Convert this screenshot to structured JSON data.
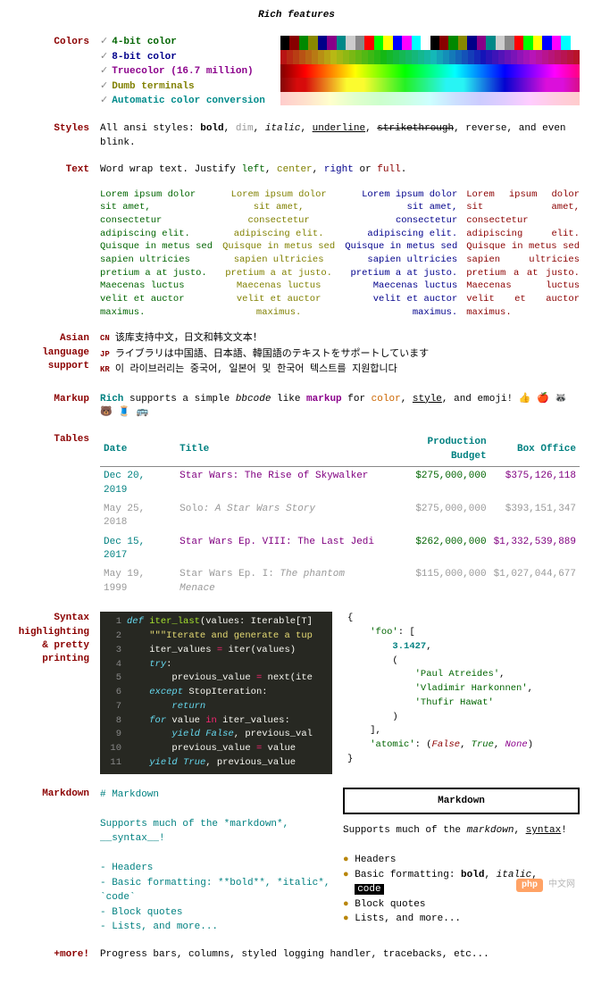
{
  "title": "Rich features",
  "labels": {
    "colors": "Colors",
    "styles": "Styles",
    "text": "Text",
    "asian": "Asian language support",
    "markup": "Markup",
    "tables": "Tables",
    "syntax": "Syntax highlighting & pretty printing",
    "markdown": "Markdown",
    "more": "+more!"
  },
  "colors": {
    "items": [
      {
        "text": "4-bit color",
        "class": "green"
      },
      {
        "text": "8-bit color",
        "class": "blue"
      },
      {
        "text": "Truecolor (16.7 million)",
        "class": "magenta"
      },
      {
        "text": "Dumb terminals",
        "class": "yellow"
      },
      {
        "text": "Automatic color conversion",
        "class": "cyan"
      }
    ]
  },
  "styles": {
    "prefix": "All ansi styles: ",
    "bold": "bold",
    "dim": "dim",
    "italic": "italic",
    "underline": "underline",
    "strike": "strikethrough",
    "suffix": ", reverse, and even blink."
  },
  "text": {
    "prefix": "Word wrap text. Justify ",
    "left": "left",
    "center": "center",
    "right": "right",
    "or": " or ",
    "full": "full",
    "period": "."
  },
  "lorem": "Lorem ipsum dolor sit amet, consectetur adipiscing elit. Quisque in metus sed sapien ultricies pretium a at justo. Maecenas luctus velit et auctor maximus.",
  "asian": {
    "cn_tag": "CN",
    "cn": "该库支持中文，日文和韩文文本！",
    "jp_tag": "JP",
    "jp": "ライブラリは中国語、日本語、韓国語のテキストをサポートしています",
    "kr_tag": "KR",
    "kr": "이 라이브러리는 중국어, 일본어 및 한국어 텍스트를 지원합니다"
  },
  "markup": {
    "p1": "Rich",
    "p2": " supports a simple ",
    "p3": "bbcode",
    "p4": " like ",
    "p5": "markup",
    "p6": " for ",
    "p7": "color",
    "p8": ", ",
    "p9": "style",
    "p10": ", and emoji! 👍 🍎 🦝 🐻 🧵 🚌"
  },
  "table": {
    "headers": [
      "Date",
      "Title",
      "Production Budget",
      "Box Office"
    ],
    "rows": [
      {
        "date": "Dec 20, 2019",
        "title": "Star Wars: The Rise of Skywalker",
        "budget": "$275,000,000",
        "box": "$375,126,118",
        "dim": false
      },
      {
        "date": "May 25, 2018",
        "title": "Solo",
        "subtitle": ": A Star Wars Story",
        "budget": "$275,000,000",
        "box": "$393,151,347",
        "dim": true
      },
      {
        "date": "Dec 15, 2017",
        "title": "Star Wars Ep. VIII: The Last Jedi",
        "budget": "$262,000,000",
        "box": "$1,332,539,889",
        "dim": false
      },
      {
        "date": "May 19, 1999",
        "title": "Star Wars Ep. I: ",
        "subtitle": "The phantom Menace",
        "budget": "$115,000,000",
        "box": "$1,027,044,677",
        "dim": true
      }
    ]
  },
  "code": {
    "l1_def": "def",
    "l1_fn": "iter_last",
    "l1_rest": "(values: Iterable[T]",
    "l2": "\"\"\"Iterate and generate a tup",
    "l3a": "iter_values ",
    "l3b": "=",
    "l3c": " iter(values)",
    "l4": "try",
    "l5a": "previous_value ",
    "l5b": "=",
    "l5c": " next(ite",
    "l6a": "except",
    "l6b": " StopIteration:",
    "l7": "return",
    "l8a": "for",
    "l8b": " value ",
    "l8c": "in",
    "l8d": " iter_values:",
    "l9a": "yield",
    "l9b": " False",
    "l9c": ", previous_val",
    "l10a": "previous_value ",
    "l10b": "=",
    "l10c": " value",
    "l11a": "yield",
    "l11b": " True",
    "l11c": ", previous_value"
  },
  "pretty": {
    "l1": "{",
    "l2a": "'foo'",
    "l2b": ": [",
    "l3": "3.1427",
    "l3b": ",",
    "l4": "(",
    "l5": "'Paul Atreides'",
    "l5b": ",",
    "l6": "'Vladimir Harkonnen'",
    "l6b": ",",
    "l7": "'Thufir Hawat'",
    "l8": ")",
    "l9": "],",
    "l10a": "'atomic'",
    "l10b": ": (",
    "l10c": "False",
    "l10d": ", ",
    "l10e": "True",
    "l10f": ", ",
    "l10g": "None",
    "l10h": ")",
    "l11": "}"
  },
  "markdown": {
    "source": {
      "heading": "# Markdown",
      "para": "Supports much of the *markdown*, __syntax__!",
      "items": [
        "- Headers",
        "- Basic formatting: **bold**, *italic*, `code`",
        "- Block quotes",
        "- Lists, and more..."
      ]
    },
    "rendered": {
      "heading": "Markdown",
      "para_pre": "Supports much of the ",
      "para_em": "markdown",
      "para_mid": ", ",
      "para_u": "syntax",
      "para_post": "!",
      "items": {
        "i1": "Headers",
        "i2a": "Basic formatting: ",
        "i2b": "bold",
        "i2c": ", ",
        "i2d": "italic",
        "i2e": ", ",
        "i2f": "code",
        "i3": "Block quotes",
        "i4": "Lists, and more..."
      }
    }
  },
  "more": "Progress bars, columns, styled logging handler, tracebacks, etc...",
  "watermark": {
    "brand": "php",
    "site": "中文网"
  }
}
